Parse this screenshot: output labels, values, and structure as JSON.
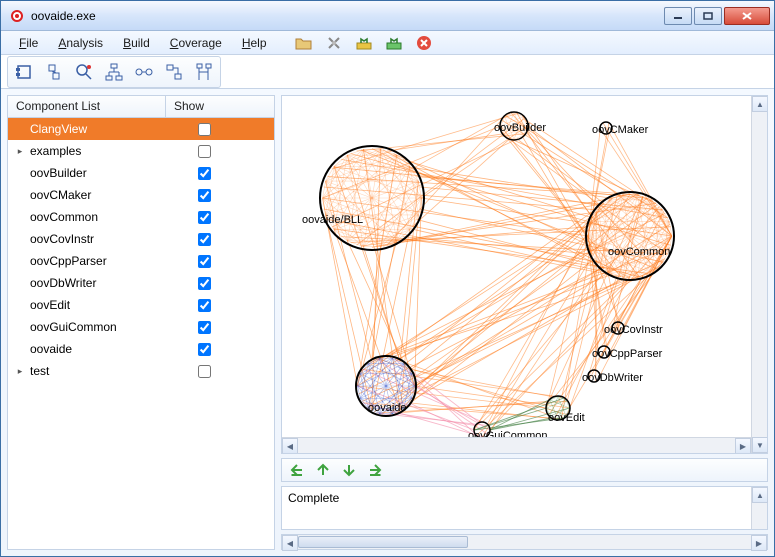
{
  "window": {
    "title": "oovaide.exe"
  },
  "menus": {
    "file": "File",
    "analysis": "Analysis",
    "build": "Build",
    "coverage": "Coverage",
    "help": "Help"
  },
  "listHeader": {
    "name": "Component List",
    "show": "Show"
  },
  "components": [
    {
      "name": "ClangView",
      "show": false,
      "expandable": false,
      "selected": true
    },
    {
      "name": "examples",
      "show": false,
      "expandable": true,
      "selected": false
    },
    {
      "name": "oovBuilder",
      "show": true,
      "expandable": false,
      "selected": false
    },
    {
      "name": "oovCMaker",
      "show": true,
      "expandable": false,
      "selected": false
    },
    {
      "name": "oovCommon",
      "show": true,
      "expandable": false,
      "selected": false
    },
    {
      "name": "oovCovInstr",
      "show": true,
      "expandable": false,
      "selected": false
    },
    {
      "name": "oovCppParser",
      "show": true,
      "expandable": false,
      "selected": false
    },
    {
      "name": "oovDbWriter",
      "show": true,
      "expandable": false,
      "selected": false
    },
    {
      "name": "oovEdit",
      "show": true,
      "expandable": false,
      "selected": false
    },
    {
      "name": "oovGuiCommon",
      "show": true,
      "expandable": false,
      "selected": false
    },
    {
      "name": "oovaide",
      "show": true,
      "expandable": false,
      "selected": false
    },
    {
      "name": "test",
      "show": false,
      "expandable": true,
      "selected": false
    }
  ],
  "graphNodes": {
    "oovBuilder": {
      "label": "oovBuilder"
    },
    "oovCMaker": {
      "label": "oovCMaker"
    },
    "oovaideBLL": {
      "label": "oovaide/BLL"
    },
    "oovCommon": {
      "label": "oovCommon"
    },
    "oovCovInstr": {
      "label": "oovCovInstr"
    },
    "oovCppParser": {
      "label": "oovCppParser"
    },
    "oovDbWriter": {
      "label": "oovDbWriter"
    },
    "oovaide": {
      "label": "oovaide"
    },
    "oovEdit": {
      "label": "oovEdit"
    },
    "oovGuiCommon": {
      "label": "oovGuiCommon"
    }
  },
  "status": {
    "text": "Complete"
  }
}
